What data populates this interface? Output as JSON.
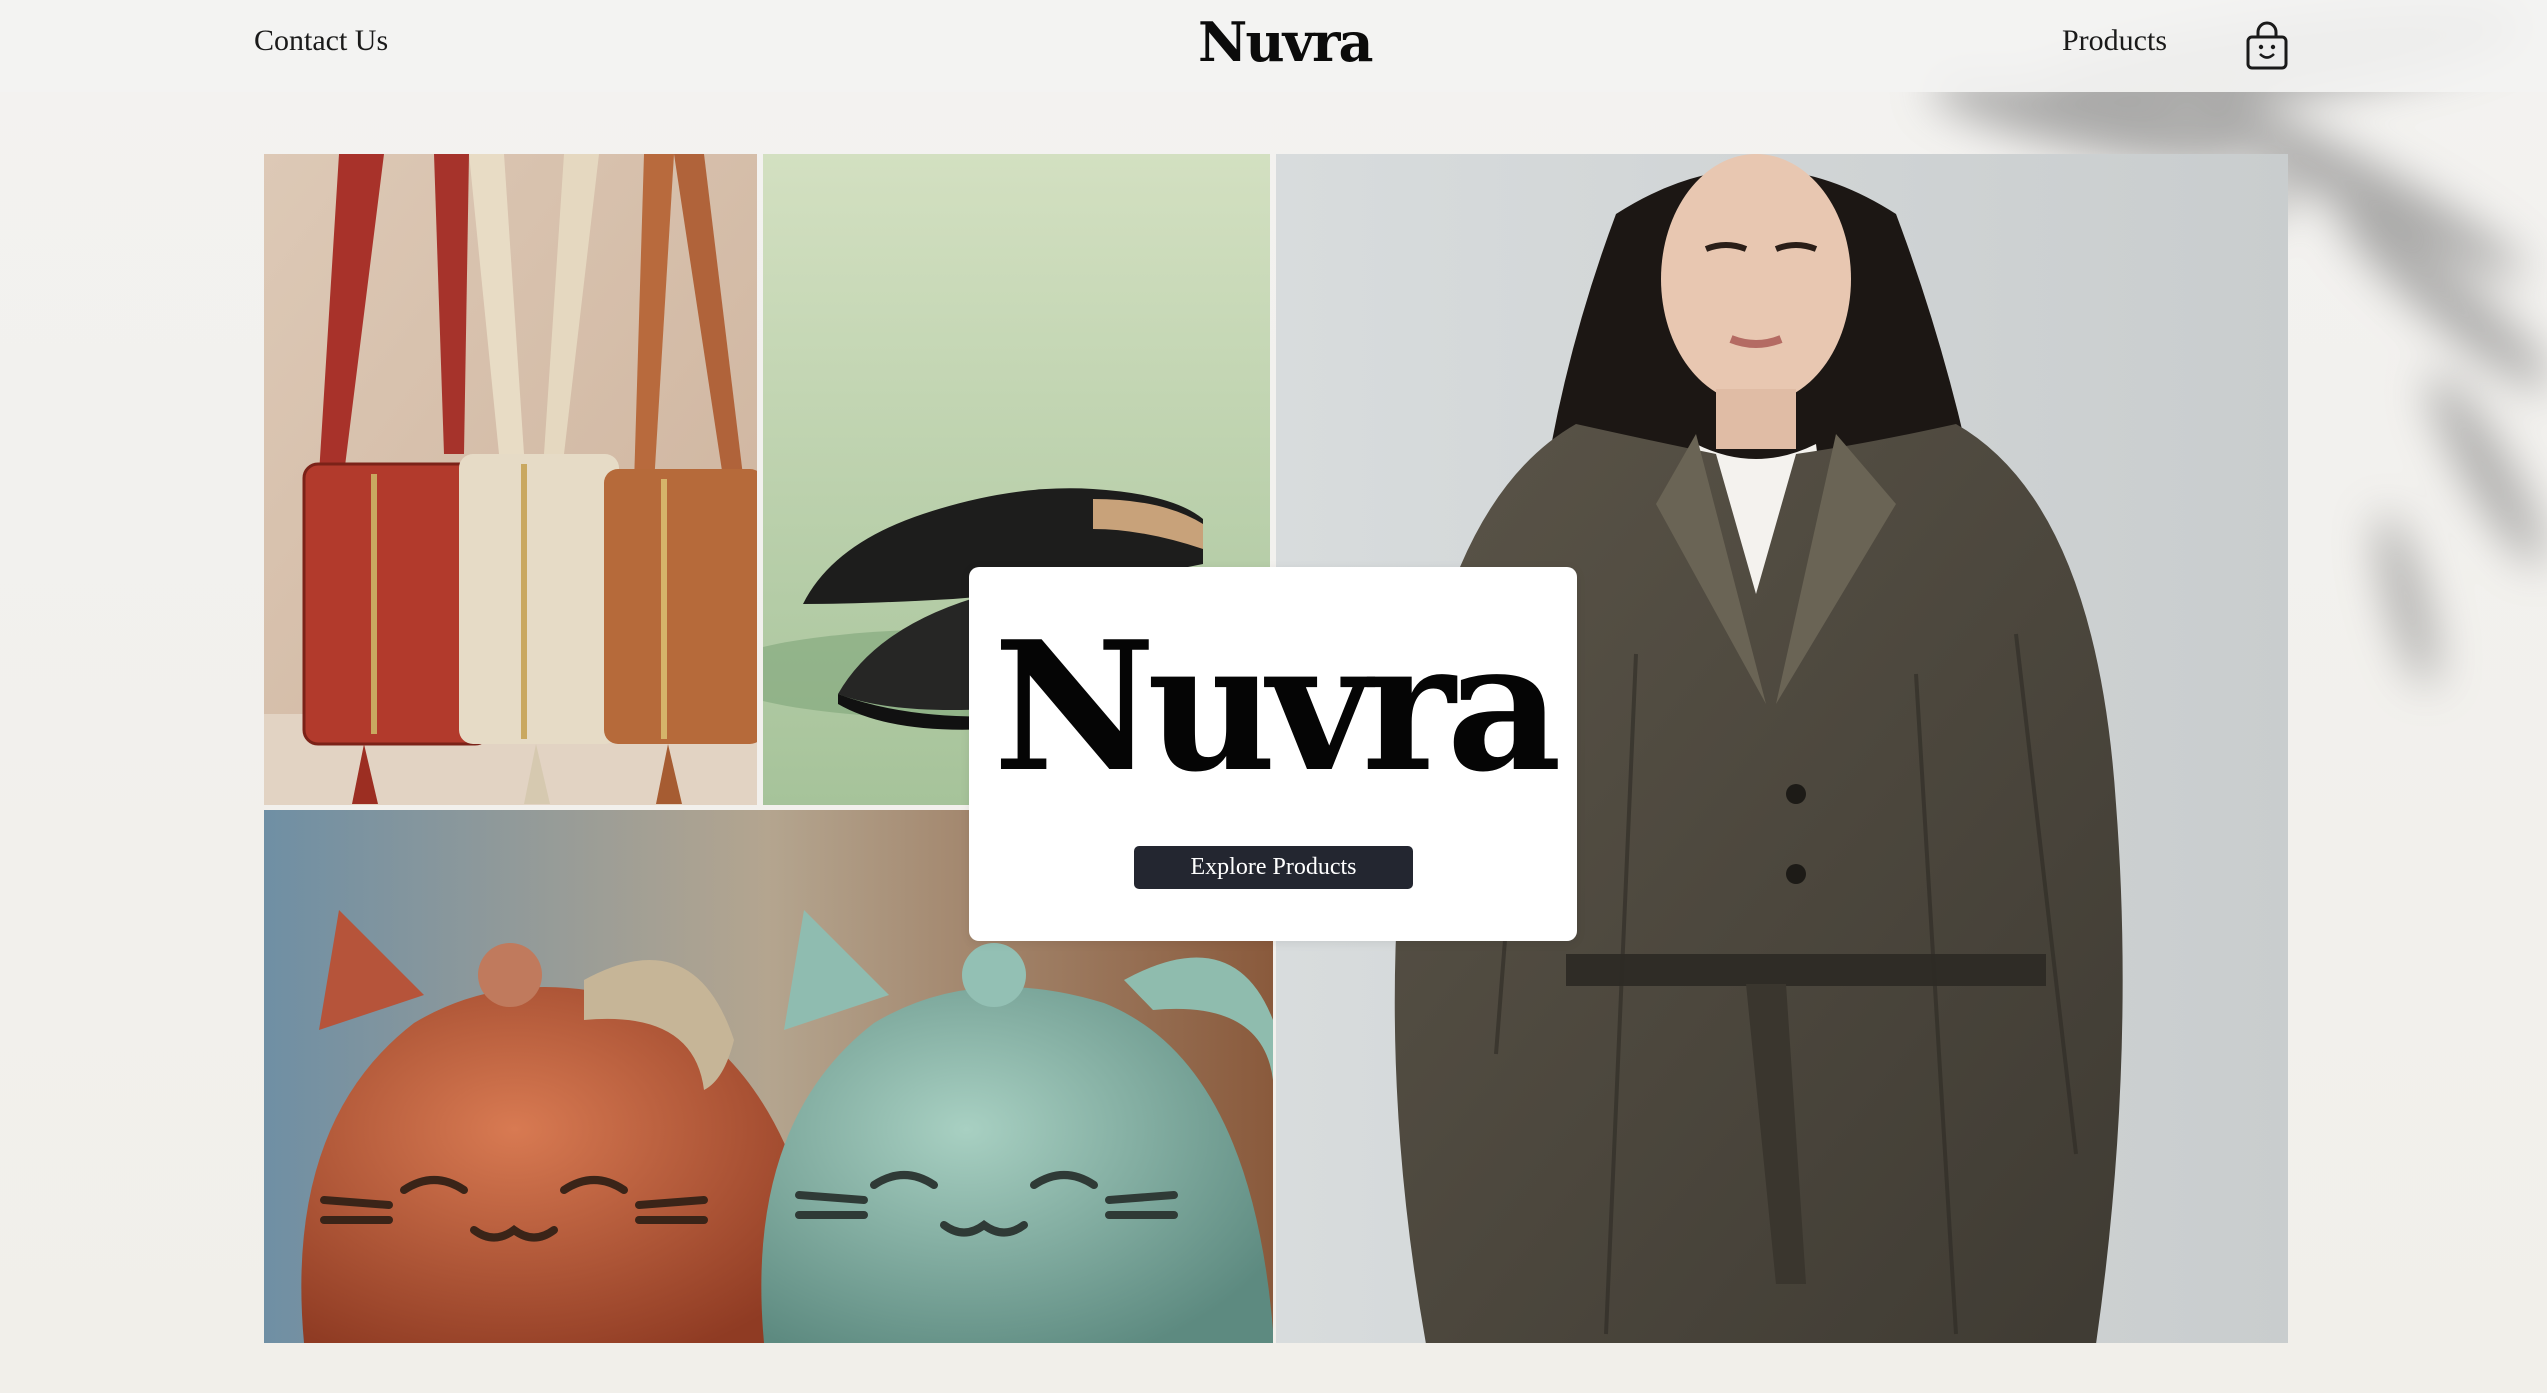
{
  "header": {
    "contact_label": "Contact Us",
    "brand": "Nuvra",
    "products_label": "Products",
    "cart_icon": "shopping-bag-icon"
  },
  "hero": {
    "title": "Nuvra",
    "cta_label": "Explore Products"
  },
  "gallery": {
    "images": [
      {
        "subject": "three leather crossbody bags (red, cream, tan)"
      },
      {
        "subject": "pair of black leather oxford shoes on green"
      },
      {
        "subject": "two cat-shaped ceramic teapots (orange, sage green)"
      },
      {
        "subject": "model wearing an olive belted trench coat"
      }
    ]
  },
  "colors": {
    "background": "#f2f1ee",
    "card": "#ffffff",
    "button": "#232630",
    "button_text": "#ffffff",
    "text": "#111111"
  }
}
